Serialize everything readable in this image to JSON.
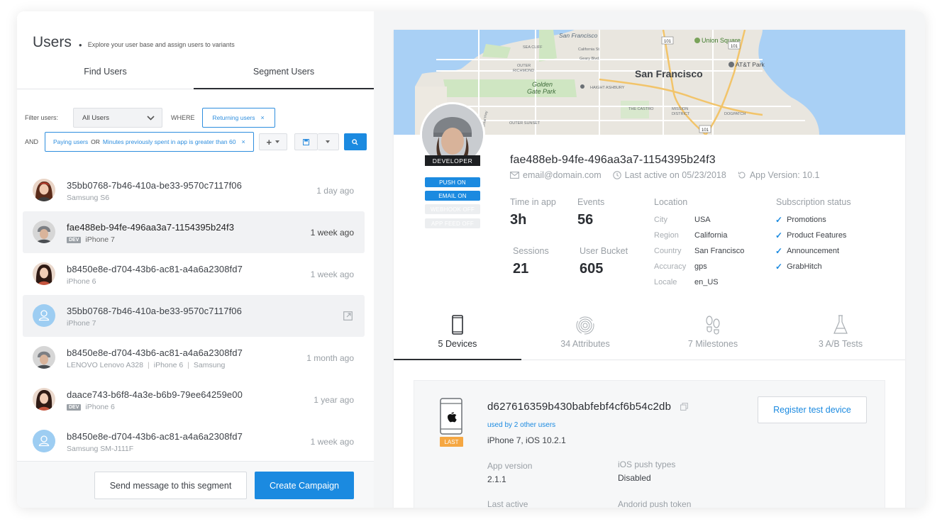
{
  "header": {
    "title": "Users",
    "subtitle": "Explore your user base and assign users to variants"
  },
  "tabs": {
    "find": "Find Users",
    "segment": "Segment Users"
  },
  "filters": {
    "filter_label": "Filter users:",
    "select_value": "All Users",
    "where_label": "WHERE",
    "chip1": "Returning users",
    "and_label": "AND",
    "chip2_a": "Paying users",
    "chip2_or": "OR",
    "chip2_b": "Minutes previously spent in app is greater than 60",
    "remove": "×"
  },
  "users": [
    {
      "id": "35bb0768-7b46-410a-be33-9570c7117f06",
      "device": "Samsung S6",
      "time": "1 day ago",
      "dev": false,
      "avatar": "photo-woman1"
    },
    {
      "id": "fae488eb-94fe-496aa3a7-1154395b24f3",
      "device": "iPhone 7",
      "time": "1 week ago",
      "dev": true,
      "dev_label": "DEV",
      "avatar": "photo-beanie",
      "highlight": true
    },
    {
      "id": "b8450e8e-d704-43b6-ac81-a4a6a2308fd7",
      "device": "iPhone 6",
      "time": "1 week ago",
      "dev": false,
      "avatar": "photo-woman2"
    },
    {
      "id": "35bb0768-7b46-410a-be33-9570c7117f06",
      "device": "iPhone 7",
      "time": "",
      "dev": false,
      "avatar": "placeholder",
      "highlight": true,
      "external": true
    },
    {
      "id": "b8450e8e-d704-43b6-ac81-a4a6a2308fd7",
      "device": "LENOVO Lenovo A328",
      "device2": "iPhone 6",
      "device3": "Samsung",
      "time": "1 month ago",
      "dev": false,
      "avatar": "photo-beanie"
    },
    {
      "id": "daace743-b6f8-4a3e-b6b9-79ee64259e00",
      "device": "iPhone 6",
      "time": "1 year ago",
      "dev": true,
      "dev_label": "DEV",
      "avatar": "photo-woman2"
    },
    {
      "id": "b8450e8e-d704-43b6-ac81-a4a6a2308fd7",
      "device": "Samsung SM-J111F",
      "time": "1 week ago",
      "dev": false,
      "avatar": "placeholder"
    }
  ],
  "footer": {
    "send": "Send message to this segment",
    "create": "Create Campaign"
  },
  "map": {
    "city": "San Francisco",
    "labels": [
      "San Francisco",
      "SEA CLIFF",
      "California St",
      "Geary Blvd",
      "OUTER RICHMOND",
      "Golden Gate Park",
      "HAIGHT ASHBURY",
      "THE CASTRO",
      "MISSION DISTRICT",
      "DOGPATCH",
      "OUTER SUNSET",
      "Union Square",
      "AT&T Park",
      "Great Hwy",
      "101",
      "101",
      "101"
    ]
  },
  "profile": {
    "badge": "DEVELOPER",
    "pills": [
      "PUSH ON",
      "EMAIL ON",
      "WEBHOOK OFF",
      "APP FEED OFF"
    ],
    "id": "fae488eb-94fe-496aa3a7-1154395b24f3",
    "email": "email@domain.com",
    "last_active": "Last active on 05/23/2018",
    "app_version": "App Version: 10.1",
    "time_in_app_label": "Time in app",
    "time_in_app": "3h",
    "events_label": "Events",
    "events": "56",
    "sessions_label": "Sessions",
    "sessions": "21",
    "bucket_label": "User Bucket",
    "bucket": "605",
    "location_label": "Location",
    "location": [
      {
        "k": "City",
        "v": "USA"
      },
      {
        "k": "Region",
        "v": "California"
      },
      {
        "k": "Country",
        "v": "San Francisco"
      },
      {
        "k": "Accuracy",
        "v": "gps"
      },
      {
        "k": "Locale",
        "v": "en_US"
      }
    ],
    "subscription_label": "Subscription status",
    "subscriptions": [
      "Promotions",
      "Product Features",
      "Announcement",
      "GrabHitch"
    ]
  },
  "profile_tabs": [
    "5 Devices",
    "34 Attributes",
    "7 Milestones",
    "3 A/B Tests"
  ],
  "device": {
    "id": "d627616359b430babfebf4cf6b54c2db",
    "used_by": "used by 2 other users",
    "model": "iPhone 7, iOS 10.2.1",
    "last_tag": "LAST",
    "register": "Register test device",
    "app_version_label": "App version",
    "app_version": "2.1.1",
    "ios_push_label": "iOS push types",
    "ios_push": "Disabled",
    "last_active_label": "Last active",
    "android_push_label": "Andorid push token"
  },
  "colors": {
    "accent": "#1b8ae0",
    "last_tag": "#f5a742",
    "dark": "#1d1f22"
  }
}
